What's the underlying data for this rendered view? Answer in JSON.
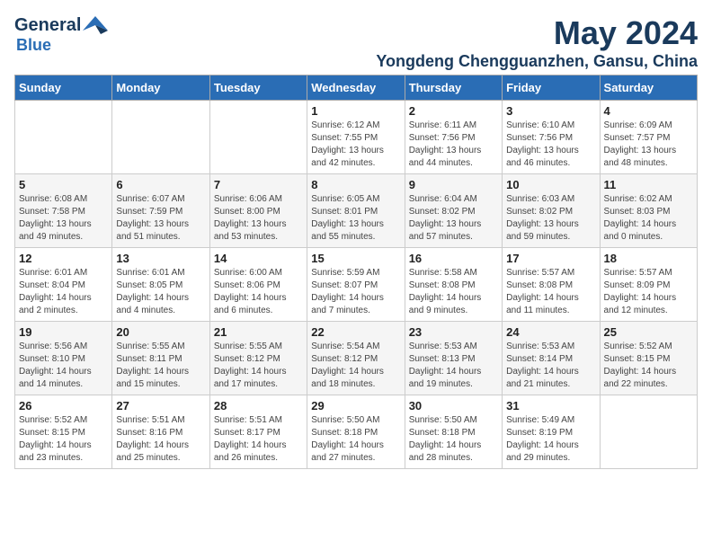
{
  "logo": {
    "line1": "General",
    "line2": "Blue"
  },
  "title": "May 2024",
  "subtitle": "Yongdeng Chengguanzhen, Gansu, China",
  "weekdays": [
    "Sunday",
    "Monday",
    "Tuesday",
    "Wednesday",
    "Thursday",
    "Friday",
    "Saturday"
  ],
  "weeks": [
    [
      {
        "day": "",
        "info": ""
      },
      {
        "day": "",
        "info": ""
      },
      {
        "day": "",
        "info": ""
      },
      {
        "day": "1",
        "info": "Sunrise: 6:12 AM\nSunset: 7:55 PM\nDaylight: 13 hours\nand 42 minutes."
      },
      {
        "day": "2",
        "info": "Sunrise: 6:11 AM\nSunset: 7:56 PM\nDaylight: 13 hours\nand 44 minutes."
      },
      {
        "day": "3",
        "info": "Sunrise: 6:10 AM\nSunset: 7:56 PM\nDaylight: 13 hours\nand 46 minutes."
      },
      {
        "day": "4",
        "info": "Sunrise: 6:09 AM\nSunset: 7:57 PM\nDaylight: 13 hours\nand 48 minutes."
      }
    ],
    [
      {
        "day": "5",
        "info": "Sunrise: 6:08 AM\nSunset: 7:58 PM\nDaylight: 13 hours\nand 49 minutes."
      },
      {
        "day": "6",
        "info": "Sunrise: 6:07 AM\nSunset: 7:59 PM\nDaylight: 13 hours\nand 51 minutes."
      },
      {
        "day": "7",
        "info": "Sunrise: 6:06 AM\nSunset: 8:00 PM\nDaylight: 13 hours\nand 53 minutes."
      },
      {
        "day": "8",
        "info": "Sunrise: 6:05 AM\nSunset: 8:01 PM\nDaylight: 13 hours\nand 55 minutes."
      },
      {
        "day": "9",
        "info": "Sunrise: 6:04 AM\nSunset: 8:02 PM\nDaylight: 13 hours\nand 57 minutes."
      },
      {
        "day": "10",
        "info": "Sunrise: 6:03 AM\nSunset: 8:02 PM\nDaylight: 13 hours\nand 59 minutes."
      },
      {
        "day": "11",
        "info": "Sunrise: 6:02 AM\nSunset: 8:03 PM\nDaylight: 14 hours\nand 0 minutes."
      }
    ],
    [
      {
        "day": "12",
        "info": "Sunrise: 6:01 AM\nSunset: 8:04 PM\nDaylight: 14 hours\nand 2 minutes."
      },
      {
        "day": "13",
        "info": "Sunrise: 6:01 AM\nSunset: 8:05 PM\nDaylight: 14 hours\nand 4 minutes."
      },
      {
        "day": "14",
        "info": "Sunrise: 6:00 AM\nSunset: 8:06 PM\nDaylight: 14 hours\nand 6 minutes."
      },
      {
        "day": "15",
        "info": "Sunrise: 5:59 AM\nSunset: 8:07 PM\nDaylight: 14 hours\nand 7 minutes."
      },
      {
        "day": "16",
        "info": "Sunrise: 5:58 AM\nSunset: 8:08 PM\nDaylight: 14 hours\nand 9 minutes."
      },
      {
        "day": "17",
        "info": "Sunrise: 5:57 AM\nSunset: 8:08 PM\nDaylight: 14 hours\nand 11 minutes."
      },
      {
        "day": "18",
        "info": "Sunrise: 5:57 AM\nSunset: 8:09 PM\nDaylight: 14 hours\nand 12 minutes."
      }
    ],
    [
      {
        "day": "19",
        "info": "Sunrise: 5:56 AM\nSunset: 8:10 PM\nDaylight: 14 hours\nand 14 minutes."
      },
      {
        "day": "20",
        "info": "Sunrise: 5:55 AM\nSunset: 8:11 PM\nDaylight: 14 hours\nand 15 minutes."
      },
      {
        "day": "21",
        "info": "Sunrise: 5:55 AM\nSunset: 8:12 PM\nDaylight: 14 hours\nand 17 minutes."
      },
      {
        "day": "22",
        "info": "Sunrise: 5:54 AM\nSunset: 8:12 PM\nDaylight: 14 hours\nand 18 minutes."
      },
      {
        "day": "23",
        "info": "Sunrise: 5:53 AM\nSunset: 8:13 PM\nDaylight: 14 hours\nand 19 minutes."
      },
      {
        "day": "24",
        "info": "Sunrise: 5:53 AM\nSunset: 8:14 PM\nDaylight: 14 hours\nand 21 minutes."
      },
      {
        "day": "25",
        "info": "Sunrise: 5:52 AM\nSunset: 8:15 PM\nDaylight: 14 hours\nand 22 minutes."
      }
    ],
    [
      {
        "day": "26",
        "info": "Sunrise: 5:52 AM\nSunset: 8:15 PM\nDaylight: 14 hours\nand 23 minutes."
      },
      {
        "day": "27",
        "info": "Sunrise: 5:51 AM\nSunset: 8:16 PM\nDaylight: 14 hours\nand 25 minutes."
      },
      {
        "day": "28",
        "info": "Sunrise: 5:51 AM\nSunset: 8:17 PM\nDaylight: 14 hours\nand 26 minutes."
      },
      {
        "day": "29",
        "info": "Sunrise: 5:50 AM\nSunset: 8:18 PM\nDaylight: 14 hours\nand 27 minutes."
      },
      {
        "day": "30",
        "info": "Sunrise: 5:50 AM\nSunset: 8:18 PM\nDaylight: 14 hours\nand 28 minutes."
      },
      {
        "day": "31",
        "info": "Sunrise: 5:49 AM\nSunset: 8:19 PM\nDaylight: 14 hours\nand 29 minutes."
      },
      {
        "day": "",
        "info": ""
      }
    ]
  ]
}
